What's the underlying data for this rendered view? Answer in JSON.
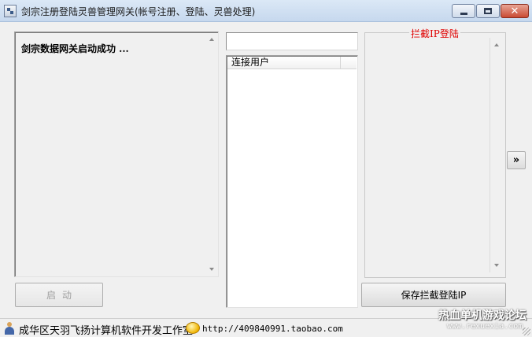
{
  "window": {
    "title": "剑宗注册登陆灵兽管理网关(帐号注册、登陆、灵兽处理)",
    "icon": "app-icon"
  },
  "log": {
    "message": "剑宗数据网关启动成功 ..."
  },
  "top_input": {
    "value": ""
  },
  "user_list": {
    "columns": [
      "连接用户",
      ""
    ],
    "rows": []
  },
  "ip_block": {
    "group_label": "拦截IP登陆",
    "entries": []
  },
  "buttons": {
    "start_label": "启动",
    "save_label": "保存拦截登陆IP",
    "expand_label": "»"
  },
  "status_bar": {
    "studio": "成华区天羽飞扬计算机软件开发工作室",
    "url": "http://409840991.taobao.com"
  },
  "watermark": {
    "main": "热血单机游戏论坛",
    "sub": "www.rexuexia.com"
  },
  "colors": {
    "group_label": "#e00000",
    "close_button": "#c94a33"
  }
}
